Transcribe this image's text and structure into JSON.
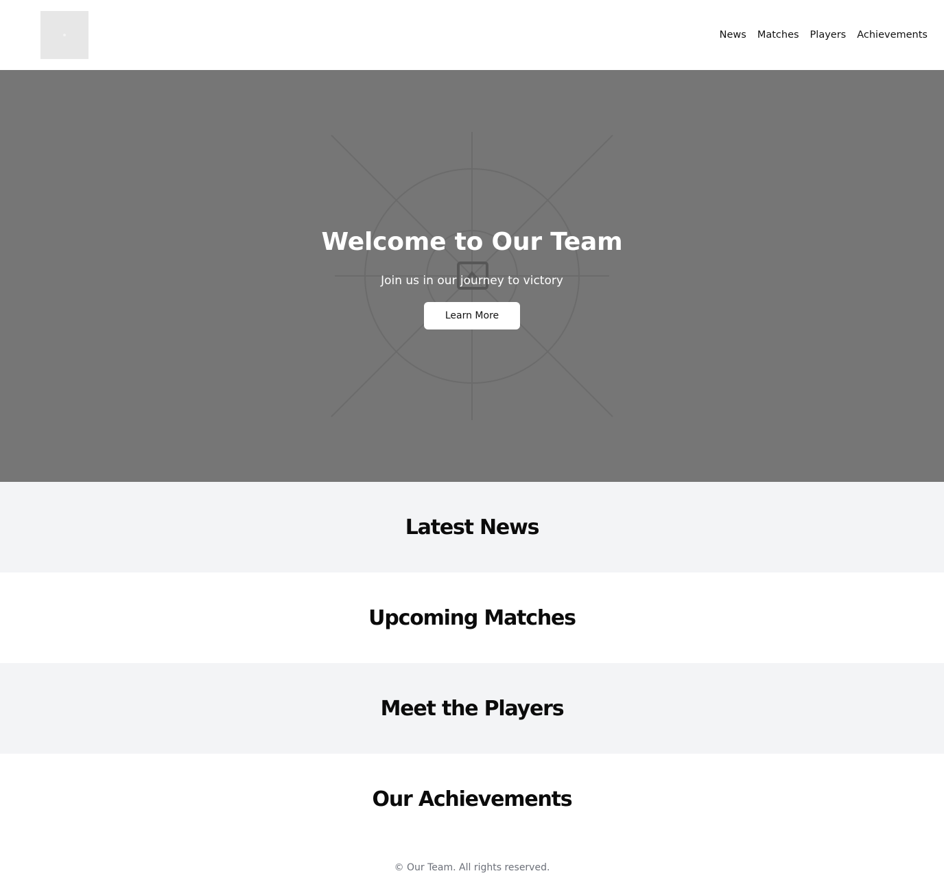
{
  "header": {
    "nav": [
      "News",
      "Matches",
      "Players",
      "Achievements"
    ]
  },
  "hero": {
    "title": "Welcome to Our Team",
    "subtitle": "Join us in our journey to victory",
    "button_label": "Learn More",
    "image_icon": "image-placeholder-icon",
    "background_color": "#767676"
  },
  "sections": {
    "news_title": "Latest News",
    "matches_title": "Upcoming Matches",
    "players_title": "Meet the Players",
    "achievements_title": "Our Achievements"
  },
  "footer": {
    "copyright": "© Our Team. All rights reserved."
  }
}
